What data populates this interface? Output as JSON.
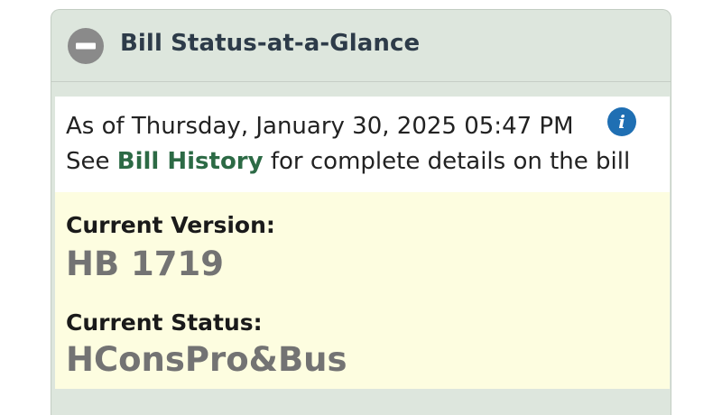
{
  "panel": {
    "title": "Bill Status-at-a-Glance",
    "collapse_icon": "minus-circle-icon"
  },
  "info": {
    "as_of": "As of Thursday, January 30, 2025 05:47 PM",
    "info_icon": "info-circle-icon",
    "see_prefix": "See ",
    "history_link": "Bill History",
    "see_suffix": " for complete details on the bill"
  },
  "status": {
    "version_label": "Current Version:",
    "version_value": "HB 1719",
    "status_label": "Current Status:",
    "status_value": "HConsPro&Bus"
  },
  "colors": {
    "header_bg": "#dde6dd",
    "link": "#2c6a45",
    "info_icon": "#1f6fb3",
    "status_bg": "#fdfde0",
    "value_text": "#737373"
  }
}
